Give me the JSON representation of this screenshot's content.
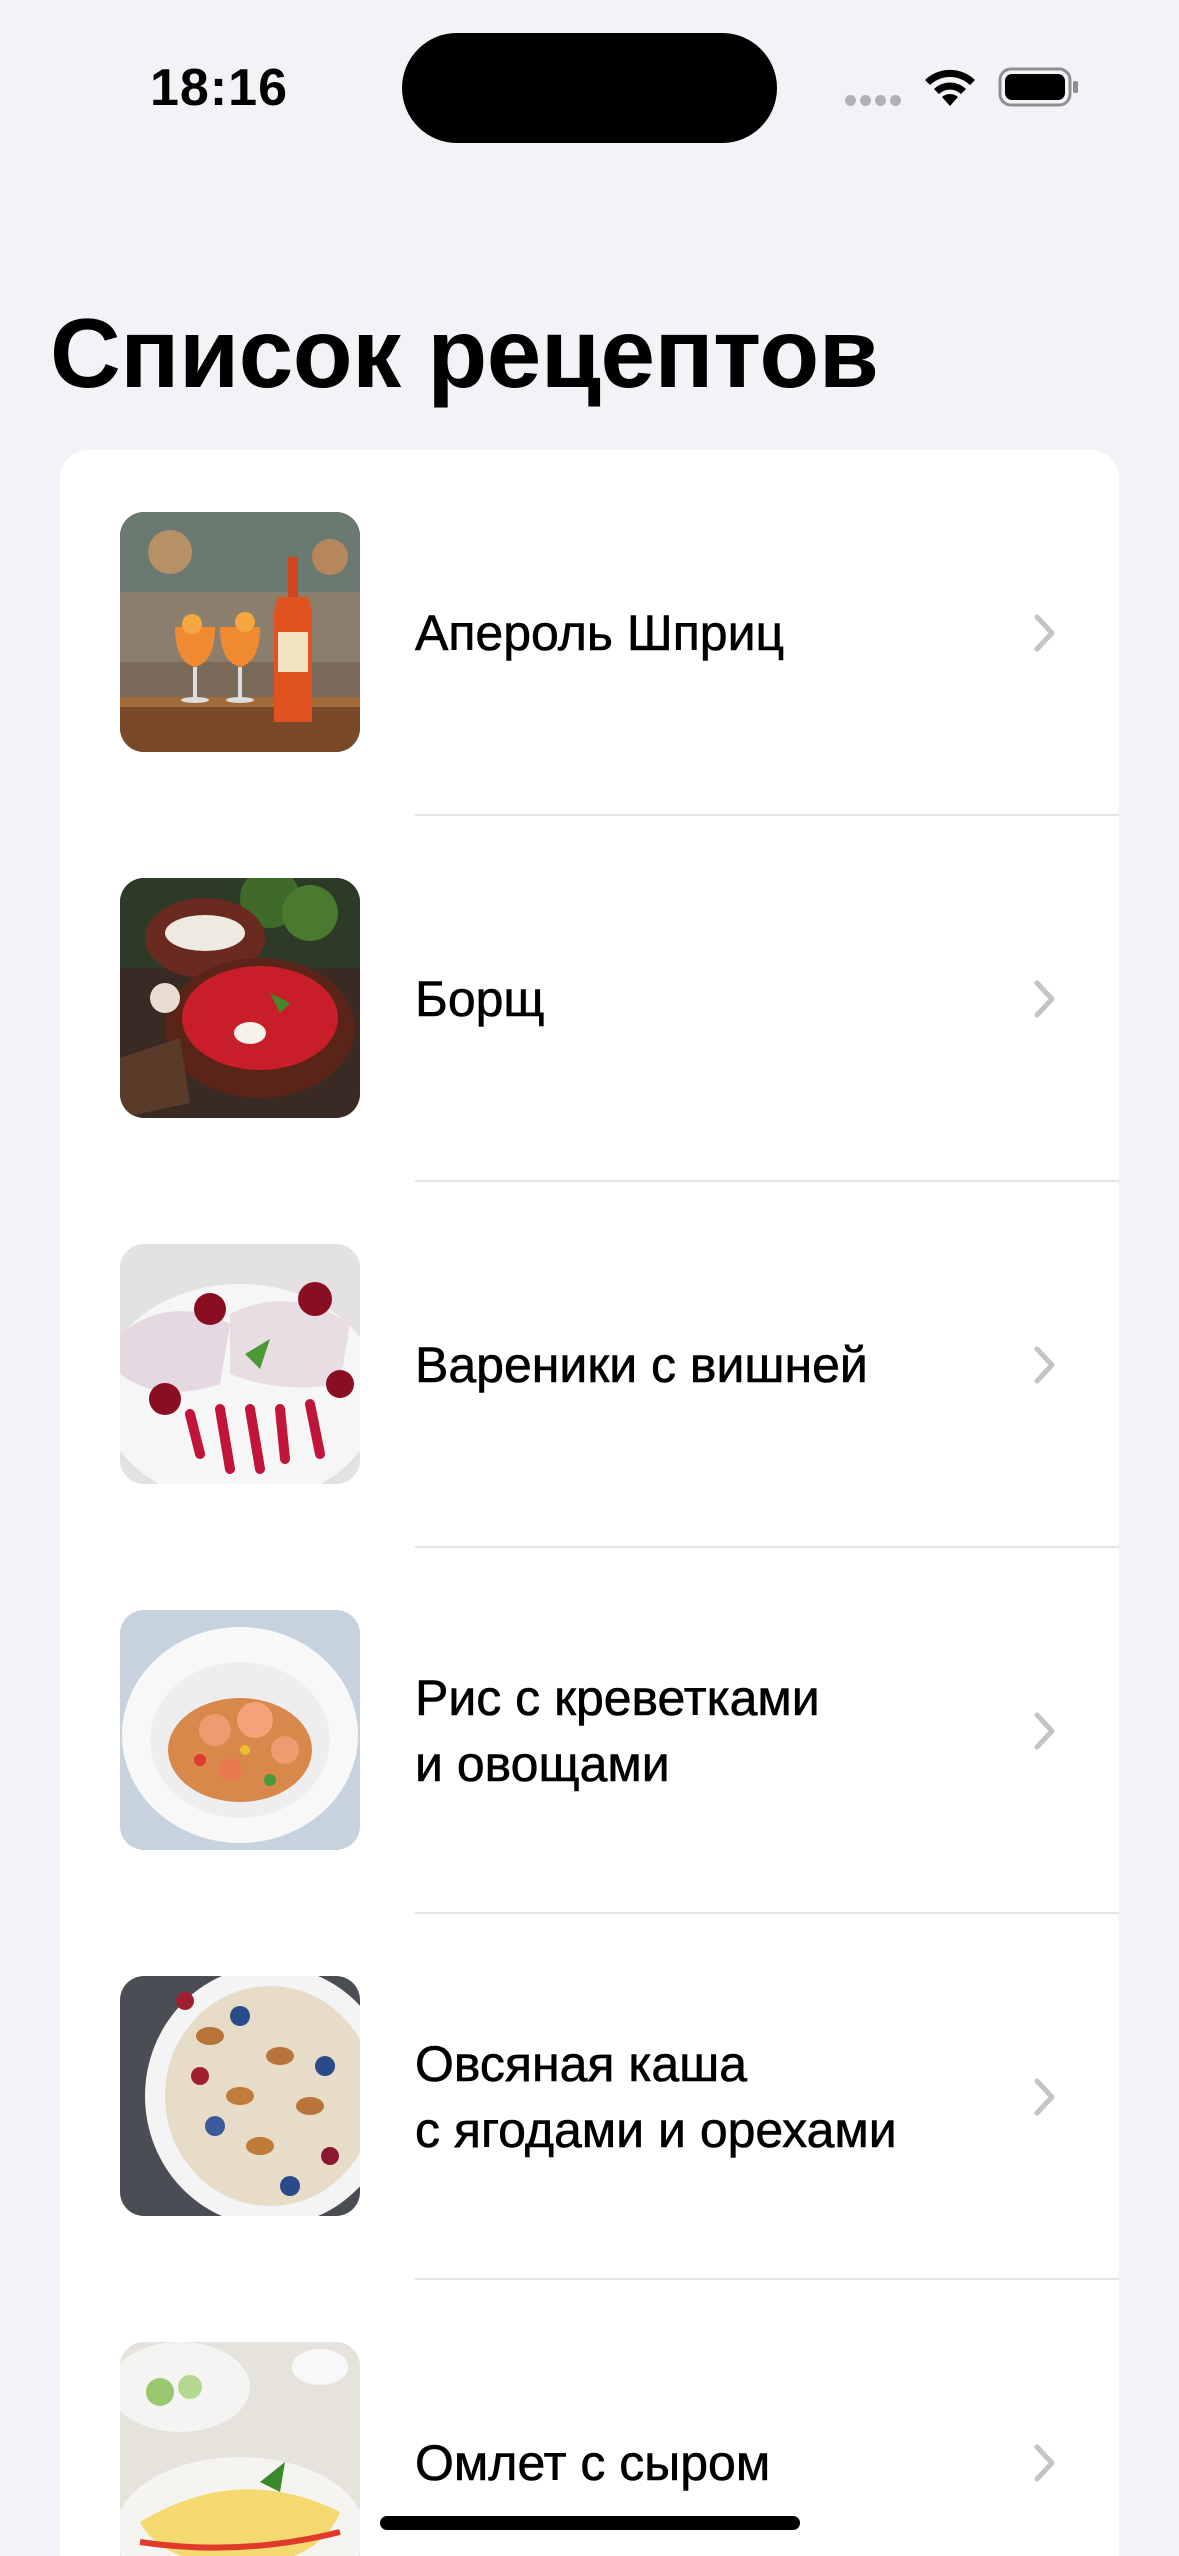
{
  "status_bar": {
    "time": "18:16"
  },
  "title": "Список рецептов",
  "recipes": [
    {
      "name": "Апероль Шприц",
      "image": "aperol-spritz-photo"
    },
    {
      "name": "Борщ",
      "image": "borscht-photo"
    },
    {
      "name": "Вареники с вишней",
      "image": "cherry-vareniki-photo"
    },
    {
      "name": "Рис с креветками\nи овощами",
      "image": "shrimp-rice-photo"
    },
    {
      "name": "Овсяная каша\nс ягодами и орехами",
      "image": "oatmeal-berries-photo"
    },
    {
      "name": "Омлет с сыром",
      "image": "cheese-omelette-photo"
    }
  ],
  "icons": {
    "row_disclosure": "chevron-right-icon",
    "wifi": "wifi-icon",
    "battery": "battery-icon"
  },
  "colors": {
    "background": "#f2f2f7",
    "card": "#ffffff",
    "chevron": "#c4c4c7",
    "divider": "#e3e3e8"
  }
}
